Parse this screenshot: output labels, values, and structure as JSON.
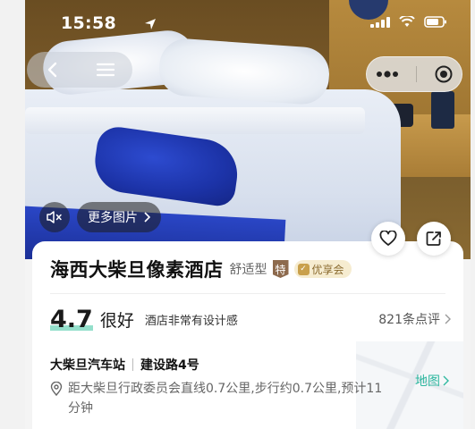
{
  "status_bar": {
    "time": "15:58"
  },
  "nav": {
    "back_icon": "chevron-left-icon",
    "menu_icon": "hamburger-menu-icon"
  },
  "miniprogram": {
    "more_icon": "more-dots-icon",
    "close_icon": "target-close-icon"
  },
  "gallery": {
    "mute_icon": "speaker-mute-icon",
    "more_pics_label": "更多图片"
  },
  "actions": {
    "favorite_icon": "heart-icon",
    "share_icon": "share-icon"
  },
  "hotel": {
    "name": "海西大柴旦像素酒店",
    "type": "舒适型",
    "badge_special": "特",
    "badge_member": "优享会",
    "score": "4.7",
    "score_word": "很好",
    "score_desc": "酒店非常有设计感",
    "reviews": "821条点评",
    "addr_part1": "大柴旦汽车站",
    "addr_part2": "建设路4号",
    "distance": "距大柴旦行政委员会直线0.7公里,步行约0.7公里,预计11分钟",
    "map_label": "地图"
  },
  "colors": {
    "accent_teal": "#2fb8a0",
    "badge_gold": "#c9a04b",
    "badge_brown": "#8d6a4d"
  }
}
